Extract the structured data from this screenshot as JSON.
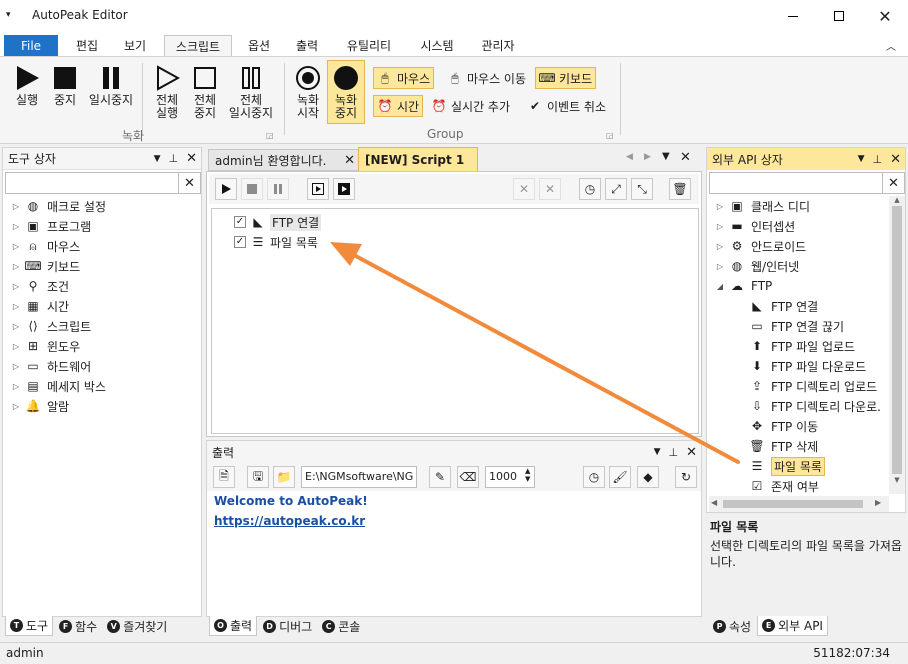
{
  "title": "AutoPeak Editor",
  "ribbon_tabs": [
    "File",
    "편집",
    "보기",
    "스크립트",
    "옵션",
    "출력",
    "유틸리티",
    "시스템",
    "관리자"
  ],
  "ribbon": {
    "run": "실행",
    "stop": "중지",
    "pause": "일시중지",
    "all_run": [
      "전체",
      "실행"
    ],
    "all_stop": [
      "전체",
      "중지"
    ],
    "all_pause": [
      "전체",
      "일시중지"
    ],
    "rec_start": [
      "녹화",
      "시작"
    ],
    "rec_stop": [
      "녹화",
      "중지"
    ],
    "group_rec": "녹화",
    "mouse": "마우스",
    "mouse_move": "마우스 이동",
    "keyboard": "키보드",
    "time": "시간",
    "realtime_add": "실시간 추가",
    "event_cancel": "이벤트 취소",
    "group_group": "Group"
  },
  "left_panel": {
    "title": "도구 상자",
    "items": [
      {
        "label": "매크로 설정",
        "icon": "globe-icon"
      },
      {
        "label": "프로그램",
        "icon": "program-icon"
      },
      {
        "label": "마우스",
        "icon": "mouse-icon"
      },
      {
        "label": "키보드",
        "icon": "keyboard-icon"
      },
      {
        "label": "조건",
        "icon": "condition-icon"
      },
      {
        "label": "시간",
        "icon": "calendar-icon"
      },
      {
        "label": "스크립트",
        "icon": "script-icon"
      },
      {
        "label": "윈도우",
        "icon": "windows-icon"
      },
      {
        "label": "하드웨어",
        "icon": "laptop-icon"
      },
      {
        "label": "메세지 박스",
        "icon": "message-box-icon"
      },
      {
        "label": "알람",
        "icon": "bell-icon"
      }
    ],
    "bottom_tabs": [
      {
        "label": "도구",
        "badge": "T"
      },
      {
        "label": "함수",
        "badge": "F"
      },
      {
        "label": "즐겨찾기",
        "badge": "V"
      }
    ]
  },
  "editor": {
    "tab1": "admin님 환영합니다.",
    "tab2": "[NEW] Script 1",
    "lines": [
      "FTP 연결",
      "파일 목록"
    ]
  },
  "output": {
    "title": "출력",
    "path": "E:\\NGMsoftware\\NG",
    "number": "1000",
    "line1": "Welcome to AutoPeak!",
    "line2": "https://autopeak.co.kr",
    "bottom_tabs": [
      {
        "label": "출력",
        "badge": "O"
      },
      {
        "label": "디버그",
        "badge": "D"
      },
      {
        "label": "콘솔",
        "badge": "C"
      }
    ]
  },
  "right_panel": {
    "title": "외부 API 상자",
    "items": [
      "클래스 디디",
      "인터셉션",
      "안드로이드",
      "웹/인터넷",
      "FTP"
    ],
    "ftp_items": [
      "FTP 연결",
      "FTP 연결 끊기",
      "FTP 파일 업로드",
      "FTP 파일 다운로드",
      "FTP 디렉토리 업로드",
      "FTP 디렉토리 다운로.",
      "FTP 이동",
      "FTP 삭제",
      "파일 목록",
      "존재 여부"
    ],
    "desc_title": "파일 목록",
    "desc_text": "선택한 디렉토리의 파일 목록을 가져옵니다.",
    "bottom_tabs": [
      {
        "label": "속성",
        "badge": "P"
      },
      {
        "label": "외부 API",
        "badge": "E"
      }
    ]
  },
  "status": {
    "user": "admin",
    "value": "51182:07:34"
  },
  "colors": {
    "accent": "#1e73c8",
    "highlight": "#fde79a",
    "arrow": "#f28a3c",
    "link": "#1a4fa3"
  }
}
